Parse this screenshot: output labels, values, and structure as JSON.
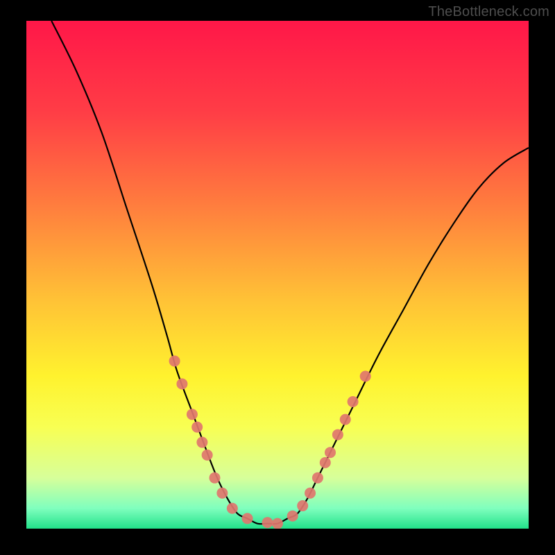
{
  "watermark": "TheBottleneck.com",
  "chart_data": {
    "type": "line",
    "title": "",
    "xlabel": "",
    "ylabel": "",
    "xlim": [
      0,
      100
    ],
    "ylim": [
      0,
      100
    ],
    "gradient_stops": [
      {
        "offset": 0,
        "color": "#ff1748"
      },
      {
        "offset": 0.18,
        "color": "#ff3d46"
      },
      {
        "offset": 0.36,
        "color": "#ff7c3e"
      },
      {
        "offset": 0.55,
        "color": "#ffc236"
      },
      {
        "offset": 0.7,
        "color": "#fff22e"
      },
      {
        "offset": 0.8,
        "color": "#f8ff53"
      },
      {
        "offset": 0.9,
        "color": "#d7ff9a"
      },
      {
        "offset": 0.96,
        "color": "#7fffbe"
      },
      {
        "offset": 1.0,
        "color": "#22e28a"
      }
    ],
    "series": [
      {
        "name": "curve",
        "x": [
          5,
          10,
          15,
          20,
          25,
          28,
          30,
          33,
          36,
          38,
          40,
          42,
          44,
          46,
          48,
          50,
          52,
          54,
          56,
          58,
          60,
          65,
          70,
          75,
          80,
          85,
          90,
          95,
          100
        ],
        "y": [
          100,
          90,
          78,
          63,
          48,
          38,
          31,
          23,
          15,
          10,
          6,
          3,
          2,
          1,
          1,
          1,
          2,
          3,
          6,
          10,
          14,
          24,
          34,
          43,
          52,
          60,
          67,
          72,
          75
        ]
      }
    ],
    "markers": [
      {
        "x": 29.5,
        "y": 33.0
      },
      {
        "x": 31.0,
        "y": 28.5
      },
      {
        "x": 33.0,
        "y": 22.5
      },
      {
        "x": 34.0,
        "y": 20.0
      },
      {
        "x": 35.0,
        "y": 17.0
      },
      {
        "x": 36.0,
        "y": 14.5
      },
      {
        "x": 37.5,
        "y": 10.0
      },
      {
        "x": 39.0,
        "y": 7.0
      },
      {
        "x": 41.0,
        "y": 4.0
      },
      {
        "x": 44.0,
        "y": 2.0
      },
      {
        "x": 48.0,
        "y": 1.2
      },
      {
        "x": 50.0,
        "y": 1.0
      },
      {
        "x": 53.0,
        "y": 2.5
      },
      {
        "x": 55.0,
        "y": 4.5
      },
      {
        "x": 56.5,
        "y": 7.0
      },
      {
        "x": 58.0,
        "y": 10.0
      },
      {
        "x": 59.5,
        "y": 13.0
      },
      {
        "x": 60.5,
        "y": 15.0
      },
      {
        "x": 62.0,
        "y": 18.5
      },
      {
        "x": 63.5,
        "y": 21.5
      },
      {
        "x": 65.0,
        "y": 25.0
      },
      {
        "x": 67.5,
        "y": 30.0
      }
    ],
    "marker_radius_px": 8
  }
}
